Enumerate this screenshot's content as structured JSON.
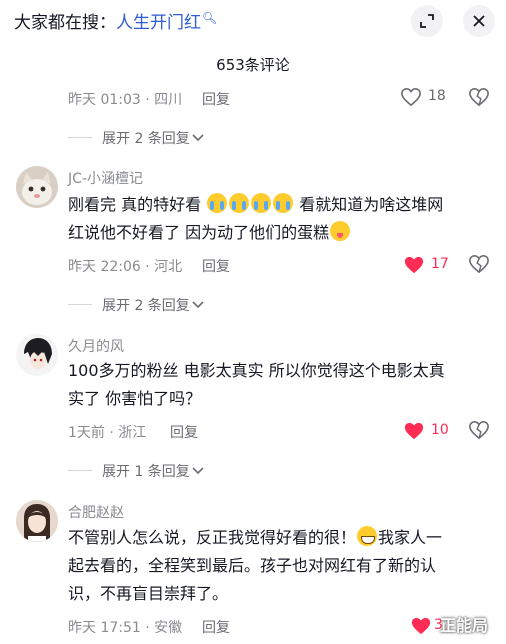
{
  "header": {
    "search_prefix": "大家都在搜：",
    "search_keyword": "人生开门红",
    "search_icon": "search-icon",
    "expand_icon": "expand-icon",
    "close_icon": "close-icon"
  },
  "comment_count": "653条评论",
  "colors": {
    "liked_heart": "#fe2c55",
    "keyword_link": "#2f5bd3",
    "meta_text": "#8a8b91"
  },
  "top_partial": {
    "meta": "昨天 01:03 · 四川",
    "reply_label": "回复",
    "likes": "18",
    "liked": false,
    "expand_label": "展开 2 条回复"
  },
  "comments": [
    {
      "username": "JC-小涵檀记",
      "text_line1_a": "刚看完 真的特好看",
      "text_line1_b": "看就知道为啥这堆网",
      "text_line2": "红说他不好看了 因为动了他们的蛋糕",
      "emojis": [
        "crying-emoji",
        "crying-emoji",
        "crying-emoji",
        "crying-emoji",
        "yum-emoji"
      ],
      "meta": "昨天 22:06 · 河北",
      "reply_label": "回复",
      "likes": "17",
      "liked": true,
      "expand_label": "展开 2 条回复"
    },
    {
      "username": "久月的风",
      "text_line1": "100多万的粉丝  电影太真实  所以你觉得这个电影太真",
      "text_line2": "实了 你害怕了吗？",
      "meta": "1天前 · 浙江",
      "reply_label": "回复",
      "likes": "10",
      "liked": true,
      "expand_label": "展开 1 条回复"
    },
    {
      "username": "合肥赵赵",
      "text_line1_a": "不管别人怎么说，反正我觉得好看的很！",
      "text_line1_b": "我家人一",
      "text_line2": "起去看的，全程笑到最后。孩子也对网红有了新的认",
      "text_line3": "识，不再盲目崇拜了。",
      "emojis": [
        "grin-emoji"
      ],
      "meta": "昨天 17:51 · 安徽",
      "reply_label": "回复",
      "likes": "3",
      "liked": true
    }
  ],
  "watermark": "正能局"
}
